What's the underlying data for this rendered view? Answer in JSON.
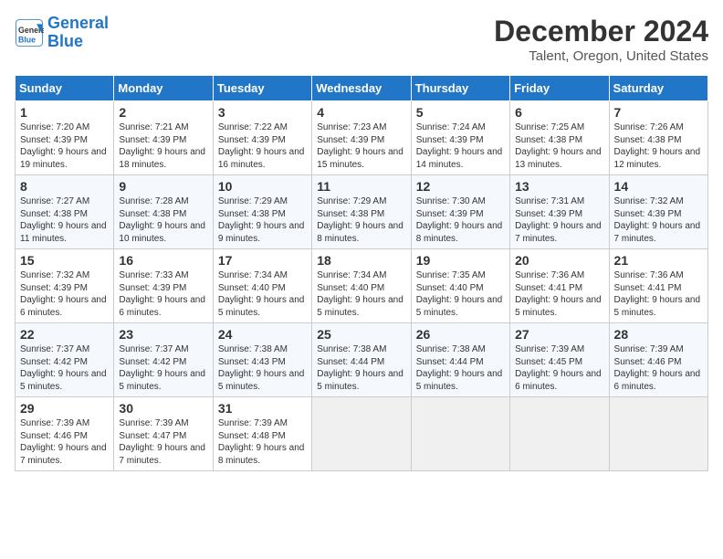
{
  "header": {
    "logo_line1": "General",
    "logo_line2": "Blue",
    "main_title": "December 2024",
    "sub_title": "Talent, Oregon, United States"
  },
  "calendar": {
    "days_of_week": [
      "Sunday",
      "Monday",
      "Tuesday",
      "Wednesday",
      "Thursday",
      "Friday",
      "Saturday"
    ],
    "weeks": [
      [
        {
          "day": "1",
          "info": "Sunrise: 7:20 AM\nSunset: 4:39 PM\nDaylight: 9 hours and 19 minutes."
        },
        {
          "day": "2",
          "info": "Sunrise: 7:21 AM\nSunset: 4:39 PM\nDaylight: 9 hours and 18 minutes."
        },
        {
          "day": "3",
          "info": "Sunrise: 7:22 AM\nSunset: 4:39 PM\nDaylight: 9 hours and 16 minutes."
        },
        {
          "day": "4",
          "info": "Sunrise: 7:23 AM\nSunset: 4:39 PM\nDaylight: 9 hours and 15 minutes."
        },
        {
          "day": "5",
          "info": "Sunrise: 7:24 AM\nSunset: 4:39 PM\nDaylight: 9 hours and 14 minutes."
        },
        {
          "day": "6",
          "info": "Sunrise: 7:25 AM\nSunset: 4:38 PM\nDaylight: 9 hours and 13 minutes."
        },
        {
          "day": "7",
          "info": "Sunrise: 7:26 AM\nSunset: 4:38 PM\nDaylight: 9 hours and 12 minutes."
        }
      ],
      [
        {
          "day": "8",
          "info": "Sunrise: 7:27 AM\nSunset: 4:38 PM\nDaylight: 9 hours and 11 minutes."
        },
        {
          "day": "9",
          "info": "Sunrise: 7:28 AM\nSunset: 4:38 PM\nDaylight: 9 hours and 10 minutes."
        },
        {
          "day": "10",
          "info": "Sunrise: 7:29 AM\nSunset: 4:38 PM\nDaylight: 9 hours and 9 minutes."
        },
        {
          "day": "11",
          "info": "Sunrise: 7:29 AM\nSunset: 4:38 PM\nDaylight: 9 hours and 8 minutes."
        },
        {
          "day": "12",
          "info": "Sunrise: 7:30 AM\nSunset: 4:39 PM\nDaylight: 9 hours and 8 minutes."
        },
        {
          "day": "13",
          "info": "Sunrise: 7:31 AM\nSunset: 4:39 PM\nDaylight: 9 hours and 7 minutes."
        },
        {
          "day": "14",
          "info": "Sunrise: 7:32 AM\nSunset: 4:39 PM\nDaylight: 9 hours and 7 minutes."
        }
      ],
      [
        {
          "day": "15",
          "info": "Sunrise: 7:32 AM\nSunset: 4:39 PM\nDaylight: 9 hours and 6 minutes."
        },
        {
          "day": "16",
          "info": "Sunrise: 7:33 AM\nSunset: 4:39 PM\nDaylight: 9 hours and 6 minutes."
        },
        {
          "day": "17",
          "info": "Sunrise: 7:34 AM\nSunset: 4:40 PM\nDaylight: 9 hours and 5 minutes."
        },
        {
          "day": "18",
          "info": "Sunrise: 7:34 AM\nSunset: 4:40 PM\nDaylight: 9 hours and 5 minutes."
        },
        {
          "day": "19",
          "info": "Sunrise: 7:35 AM\nSunset: 4:40 PM\nDaylight: 9 hours and 5 minutes."
        },
        {
          "day": "20",
          "info": "Sunrise: 7:36 AM\nSunset: 4:41 PM\nDaylight: 9 hours and 5 minutes."
        },
        {
          "day": "21",
          "info": "Sunrise: 7:36 AM\nSunset: 4:41 PM\nDaylight: 9 hours and 5 minutes."
        }
      ],
      [
        {
          "day": "22",
          "info": "Sunrise: 7:37 AM\nSunset: 4:42 PM\nDaylight: 9 hours and 5 minutes."
        },
        {
          "day": "23",
          "info": "Sunrise: 7:37 AM\nSunset: 4:42 PM\nDaylight: 9 hours and 5 minutes."
        },
        {
          "day": "24",
          "info": "Sunrise: 7:38 AM\nSunset: 4:43 PM\nDaylight: 9 hours and 5 minutes."
        },
        {
          "day": "25",
          "info": "Sunrise: 7:38 AM\nSunset: 4:44 PM\nDaylight: 9 hours and 5 minutes."
        },
        {
          "day": "26",
          "info": "Sunrise: 7:38 AM\nSunset: 4:44 PM\nDaylight: 9 hours and 5 minutes."
        },
        {
          "day": "27",
          "info": "Sunrise: 7:39 AM\nSunset: 4:45 PM\nDaylight: 9 hours and 6 minutes."
        },
        {
          "day": "28",
          "info": "Sunrise: 7:39 AM\nSunset: 4:46 PM\nDaylight: 9 hours and 6 minutes."
        }
      ],
      [
        {
          "day": "29",
          "info": "Sunrise: 7:39 AM\nSunset: 4:46 PM\nDaylight: 9 hours and 7 minutes."
        },
        {
          "day": "30",
          "info": "Sunrise: 7:39 AM\nSunset: 4:47 PM\nDaylight: 9 hours and 7 minutes."
        },
        {
          "day": "31",
          "info": "Sunrise: 7:39 AM\nSunset: 4:48 PM\nDaylight: 9 hours and 8 minutes."
        },
        null,
        null,
        null,
        null
      ]
    ]
  }
}
